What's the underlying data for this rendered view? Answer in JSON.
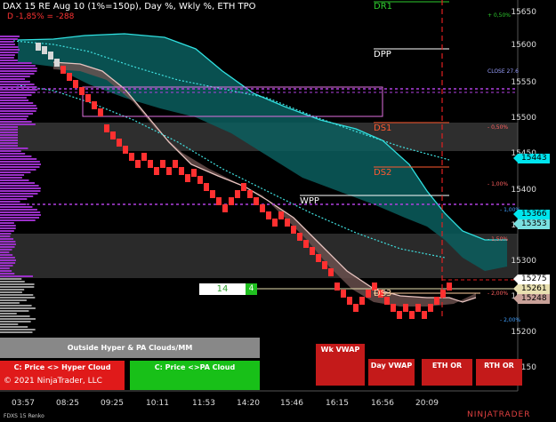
{
  "header": {
    "title": "DAX 15 RE Aug 10 (1%=150p), Day %, Wkly %, ETH TPO",
    "sub": "D -1,85% = -288"
  },
  "levels": {
    "dr1": "DR1",
    "dpp": "DPP",
    "ds1": "DS1",
    "ds2": "DS2",
    "wpp": "WPP",
    "ds3": "DS3"
  },
  "pct_labels": {
    "p050": "+ 0,50%",
    "close": "CLOSE 27.6",
    "m050": "- 0,50%",
    "m100": "- 1,00%",
    "m100b": "- 1,00%",
    "m150": "- 1,50%",
    "m200": "- 2,00%",
    "m200b": "- 2,00%"
  },
  "price_ticks": [
    "15650",
    "15600",
    "15550",
    "15500",
    "15450",
    "15400",
    "15350",
    "15300",
    "15250",
    "15200",
    "15150"
  ],
  "price_tags": [
    {
      "value": "15443",
      "color": "#00e5ee"
    },
    {
      "value": "15366",
      "color": "#00e5ee"
    },
    {
      "value": "15353",
      "color": "#7ae0e0"
    },
    {
      "value": "15275",
      "color": "#ffffff"
    },
    {
      "value": "15261",
      "color": "#e8e0b0"
    },
    {
      "value": "15248",
      "color": "#c8a098"
    }
  ],
  "time_ticks": [
    "03:57",
    "08:25",
    "09:25",
    "10:11",
    "11:53",
    "14:20",
    "15:46",
    "16:15",
    "16:56",
    "20:09"
  ],
  "counter": {
    "left": "14",
    "right": "4"
  },
  "buttons": {
    "outside": "Outside Hyper & PA Clouds/MM",
    "hyper": "C: Price <> Hyper Cloud",
    "pa": "C: Price <>PA Cloud",
    "wk_vwap": "Wk VWAP",
    "day_vwap": "Day VWAP",
    "eth_or": "ETH OR",
    "rth_or": "RTH OR"
  },
  "footer": {
    "copyright": "© 2021 NinjaTrader, LLC",
    "instrument": "FDXS 15 Renko",
    "brand": "NINJATRADER"
  },
  "colors": {
    "up": "#ff3030",
    "down": "#ff2020",
    "hyper_cloud": "#0a5a5a",
    "pa_cloud": "#7a5a58",
    "profile": "#9b30c8"
  }
}
